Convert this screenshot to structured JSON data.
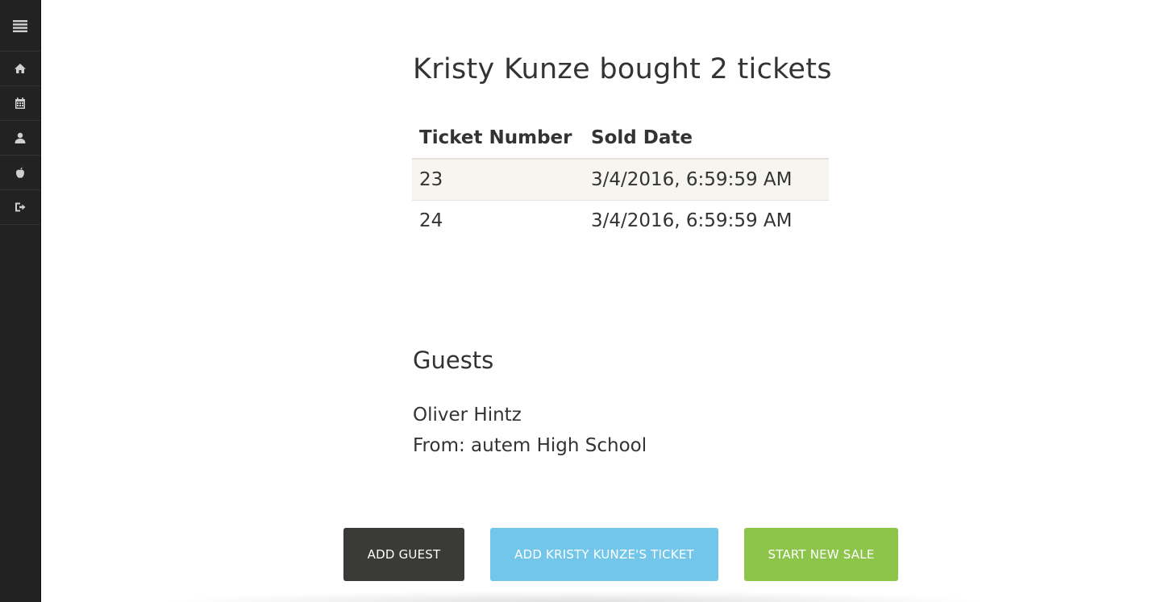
{
  "sidebar": {
    "items": [
      {
        "icon": "menu-icon"
      },
      {
        "icon": "home-icon"
      },
      {
        "icon": "calendar-icon"
      },
      {
        "icon": "user-icon"
      },
      {
        "icon": "apple-icon"
      },
      {
        "icon": "sign-out-icon"
      }
    ]
  },
  "purchase": {
    "title": "Kristy Kunze bought 2 tickets",
    "table": {
      "headers": [
        "Ticket Number",
        "Sold Date"
      ],
      "rows": [
        [
          "23",
          "3/4/2016, 6:59:59 AM"
        ],
        [
          "24",
          "3/4/2016, 6:59:59 AM"
        ]
      ]
    }
  },
  "guests": {
    "heading": "Guests",
    "name": "Oliver Hintz",
    "from": "From: autem High School"
  },
  "actions": {
    "add_guest": "Add Guest",
    "add_ticket": "Add Kristy Kunze's Ticket",
    "new_sale": "Start New Sale"
  },
  "colors": {
    "sidebar_bg": "#222222",
    "add_guest_bg": "#3a3a38",
    "add_ticket_bg": "#72c6ea",
    "new_sale_bg": "#8dc54b",
    "row_stripe": "#f7f5f0"
  }
}
